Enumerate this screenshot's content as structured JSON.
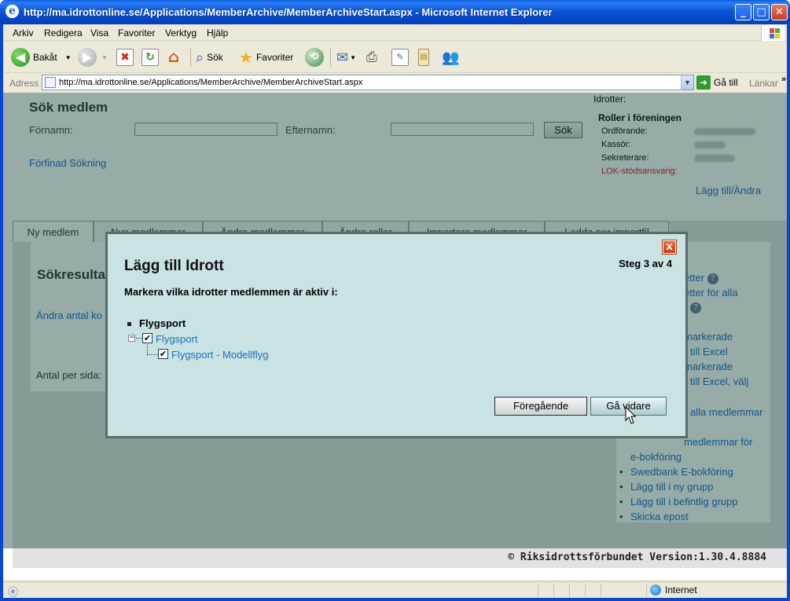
{
  "window": {
    "title": "http://ma.idrottonline.se/Applications/MemberArchive/MemberArchiveStart.aspx - Microsoft Internet Explorer"
  },
  "menu": [
    "Arkiv",
    "Redigera",
    "Visa",
    "Favoriter",
    "Verktyg",
    "Hjälp"
  ],
  "toolbar": {
    "back_label": "Bakåt",
    "search_label": "Sök",
    "favorites_label": "Favoriter"
  },
  "address": {
    "label": "Adress",
    "url": "http://ma.idrottonline.se/Applications/MemberArchive/MemberArchiveStart.aspx",
    "go_label": "Gå till",
    "links_label": "Länkar"
  },
  "search": {
    "title": "Sök medlem",
    "firstname_label": "Förnamn:",
    "lastname_label": "Efternamn:",
    "search_button": "Sök",
    "refined_search": "Förfinad Sökning"
  },
  "roles": {
    "sports_label": "Idrotter:",
    "heading": "Roller i föreningen",
    "items": [
      "Ordförande:",
      "Kassör:",
      "Sekreterare:",
      "LOK-stödsansvarig:"
    ],
    "add_change": "Lägg till/Ändra"
  },
  "tabs": [
    "Ny medlem",
    "Nya medlemmar",
    "Ändra medlemmar",
    "Ändra roller",
    "Importera medlemmar",
    "Ladda ner importfil"
  ],
  "content": {
    "results_title": "Sökresultat",
    "change_count": "Ändra antal ko",
    "per_page": "Antal per sida:"
  },
  "sidebar": {
    "items": [
      "etter",
      "etter för alla",
      "markerade",
      "till Excel",
      "markerade",
      "till Excel, välj",
      "alla medlemmar",
      "medlemmar för",
      "e-bokföring",
      "Swedbank E-bokföring",
      "Lägg till i ny grupp",
      "Lägg till i befintlig grupp",
      "Skicka epost"
    ]
  },
  "footer": {
    "copyright": "© Riksidrottsförbundet  Version:1.30.4.8884"
  },
  "modal": {
    "title": "Lägg till Idrott",
    "step": "Steg 3 av 4",
    "instruction": "Markera vilka idrotter medlemmen är aktiv i:",
    "group": "Flygsport",
    "tree": [
      {
        "label": "Flygsport",
        "checked": true
      },
      {
        "label": "Flygsport - Modellflyg",
        "checked": true
      }
    ],
    "prev_button": "Föregående",
    "next_button": "Gå vidare",
    "close_glyph": "X"
  },
  "status": {
    "zone": "Internet"
  }
}
